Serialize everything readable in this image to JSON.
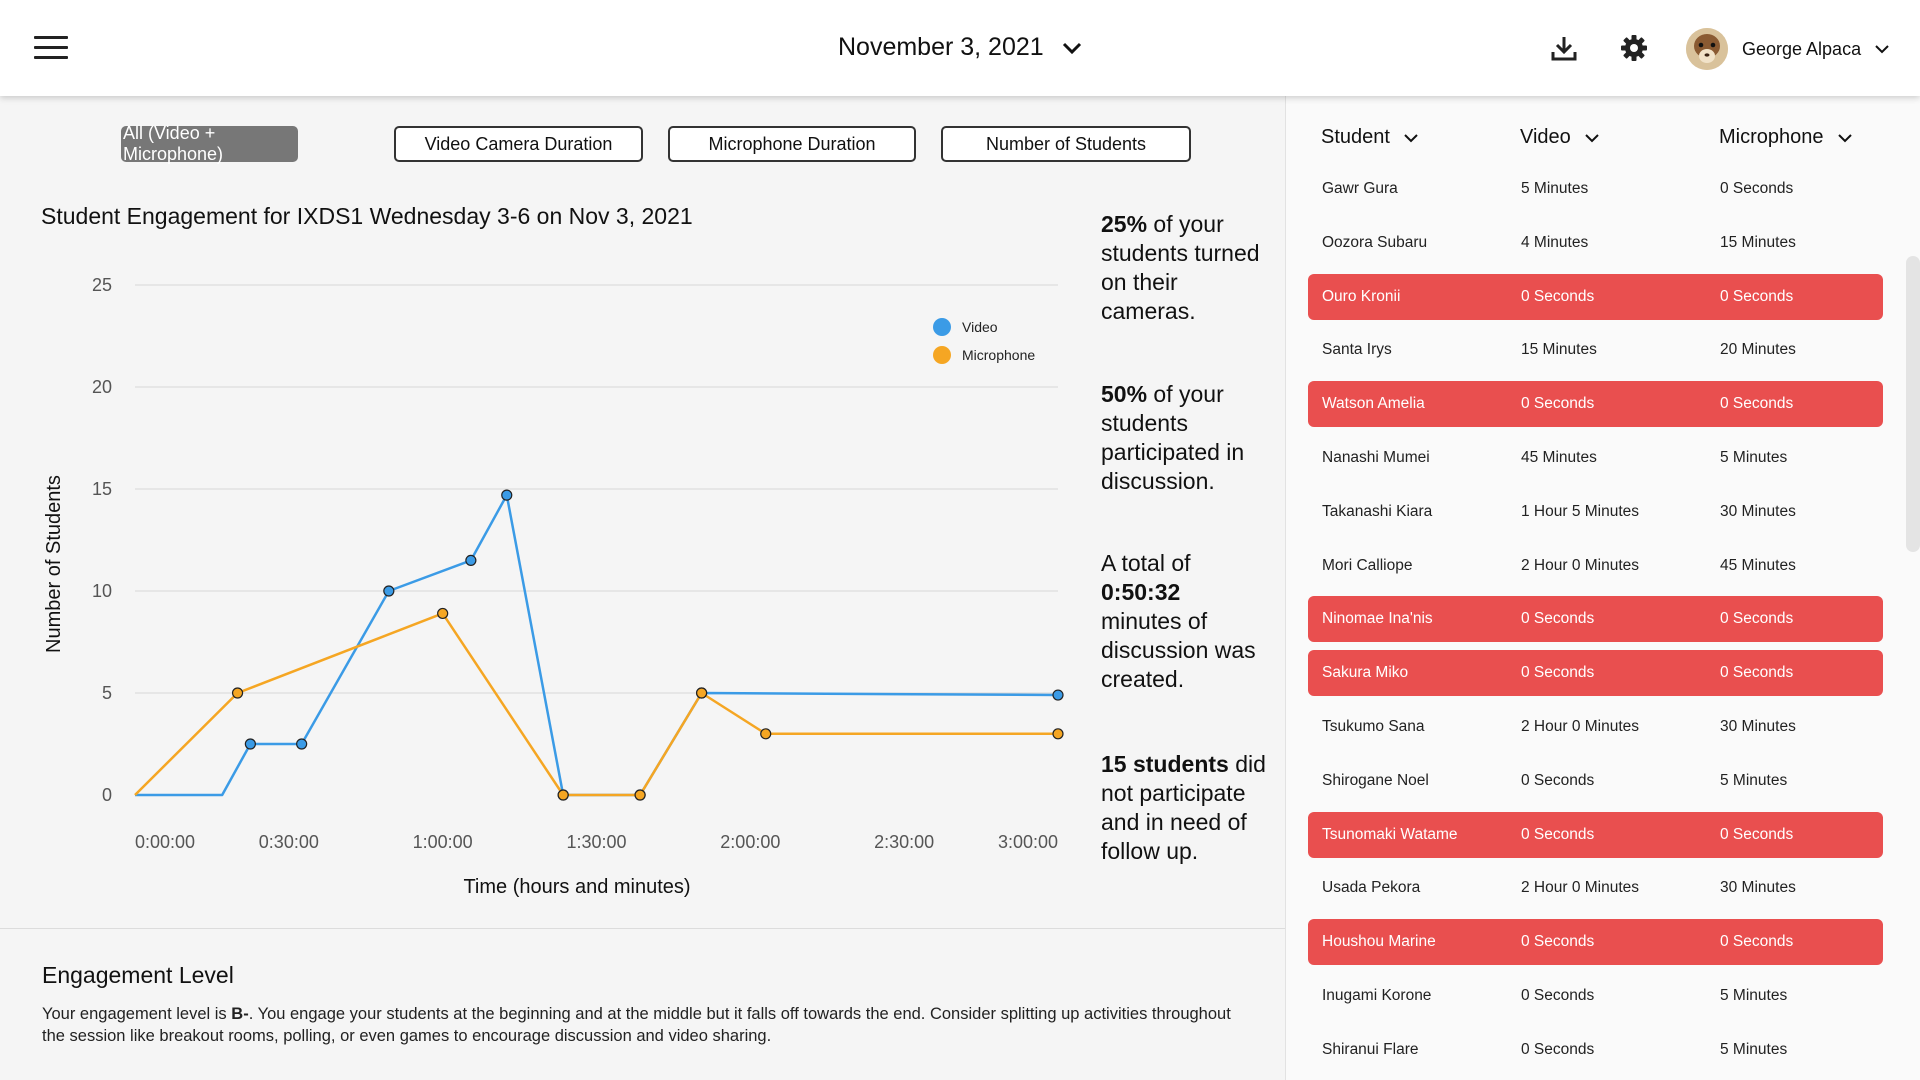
{
  "header": {
    "date": "November 3, 2021",
    "user_name": "George Alpaca"
  },
  "tabs": [
    {
      "label": "All (Video + Microphone)",
      "active": true
    },
    {
      "label": "Video Camera Duration",
      "active": false
    },
    {
      "label": "Microphone Duration",
      "active": false
    },
    {
      "label": "Number of Students",
      "active": false
    }
  ],
  "chart_data": {
    "type": "line",
    "title": "Student Engagement for IXDS1 Wednesday 3-6 on Nov 3, 2021",
    "xlabel": "Time (hours and minutes)",
    "ylabel": "Number of Students",
    "xlim": [
      0,
      180
    ],
    "ylim": [
      0,
      25
    ],
    "x_ticks": [
      0,
      30,
      60,
      90,
      120,
      150,
      180
    ],
    "x_tick_labels": [
      "0:00:00",
      "0:30:00",
      "1:00:00",
      "1:30:00",
      "2:00:00",
      "2:30:00",
      "3:00:00"
    ],
    "y_ticks": [
      0,
      5,
      10,
      15,
      20,
      25
    ],
    "grid": "horizontal",
    "legend_position": "top-right",
    "series": [
      {
        "name": "Video",
        "color": "#3b9be6",
        "points": [
          [
            0,
            0
          ],
          [
            17,
            0
          ],
          [
            22.5,
            2.5
          ],
          [
            32.5,
            2.5
          ],
          [
            49.5,
            10
          ],
          [
            65.5,
            11.5
          ],
          [
            72.5,
            14.7
          ],
          [
            83.5,
            0
          ],
          [
            98.5,
            0
          ],
          [
            110.5,
            5
          ],
          [
            180,
            4.9
          ]
        ],
        "markers_from_index": 2
      },
      {
        "name": "Microphone",
        "color": "#f5a623",
        "points": [
          [
            0,
            0
          ],
          [
            20,
            5
          ],
          [
            60,
            8.9
          ],
          [
            83.5,
            0
          ],
          [
            98.5,
            0
          ],
          [
            110.5,
            5
          ],
          [
            123,
            3
          ],
          [
            180,
            3
          ]
        ],
        "markers_from_index": 1
      }
    ]
  },
  "stats": [
    {
      "bold": "25%",
      "text": " of your students turned on their cameras."
    },
    {
      "bold": "50%",
      "text": " of your students participated in discussion."
    },
    {
      "pre": "A total of ",
      "bold": "0:50:32",
      "text": " minutes of discussion was created."
    },
    {
      "bold": "15 students",
      "text": " did not participate and in need of follow up."
    }
  ],
  "engagement": {
    "title": "Engagement Level",
    "pre": "Your engagement level is ",
    "grade": "B-",
    "text": ". You engage your students at the beginning and at the middle but it falls off towards the end. Consider splitting up activities throughout the session like breakout rooms, polling, or even games to encourage discussion and video sharing."
  },
  "table": {
    "headers": [
      "Student",
      "Video",
      "Microphone"
    ],
    "alert_color": "#e94f4f",
    "rows": [
      {
        "student": "Gawr Gura",
        "video": "5 Minutes",
        "mic": "0 Seconds",
        "alert": false
      },
      {
        "student": "Oozora Subaru",
        "video": "4 Minutes",
        "mic": "15 Minutes",
        "alert": false
      },
      {
        "student": "Ouro Kronii",
        "video": "0 Seconds",
        "mic": "0 Seconds",
        "alert": true
      },
      {
        "student": "Santa Irys",
        "video": "15 Minutes",
        "mic": "20 Minutes",
        "alert": false
      },
      {
        "student": "Watson Amelia",
        "video": "0 Seconds",
        "mic": "0 Seconds",
        "alert": true
      },
      {
        "student": "Nanashi Mumei",
        "video": "45 Minutes",
        "mic": "5 Minutes",
        "alert": false
      },
      {
        "student": "Takanashi Kiara",
        "video": "1 Hour 5 Minutes",
        "mic": "30 Minutes",
        "alert": false
      },
      {
        "student": "Mori Calliope",
        "video": "2 Hour 0 Minutes",
        "mic": "45 Minutes",
        "alert": false
      },
      {
        "student": "Ninomae Ina'nis",
        "video": "0 Seconds",
        "mic": "0 Seconds",
        "alert": true
      },
      {
        "student": "Sakura Miko",
        "video": "0 Seconds",
        "mic": "0 Seconds",
        "alert": true
      },
      {
        "student": "Tsukumo Sana",
        "video": "2 Hour 0 Minutes",
        "mic": "30 Minutes",
        "alert": false
      },
      {
        "student": "Shirogane Noel",
        "video": "0 Seconds",
        "mic": "5 Minutes",
        "alert": false
      },
      {
        "student": "Tsunomaki Watame",
        "video": "0 Seconds",
        "mic": "0 Seconds",
        "alert": true
      },
      {
        "student": "Usada Pekora",
        "video": "2 Hour 0 Minutes",
        "mic": "30 Minutes",
        "alert": false
      },
      {
        "student": "Houshou Marine",
        "video": "0 Seconds",
        "mic": "0 Seconds",
        "alert": true
      },
      {
        "student": "Inugami Korone",
        "video": "0 Seconds",
        "mic": "5 Minutes",
        "alert": false
      },
      {
        "student": "Shiranui Flare",
        "video": "0 Seconds",
        "mic": "5 Minutes",
        "alert": false
      }
    ]
  }
}
